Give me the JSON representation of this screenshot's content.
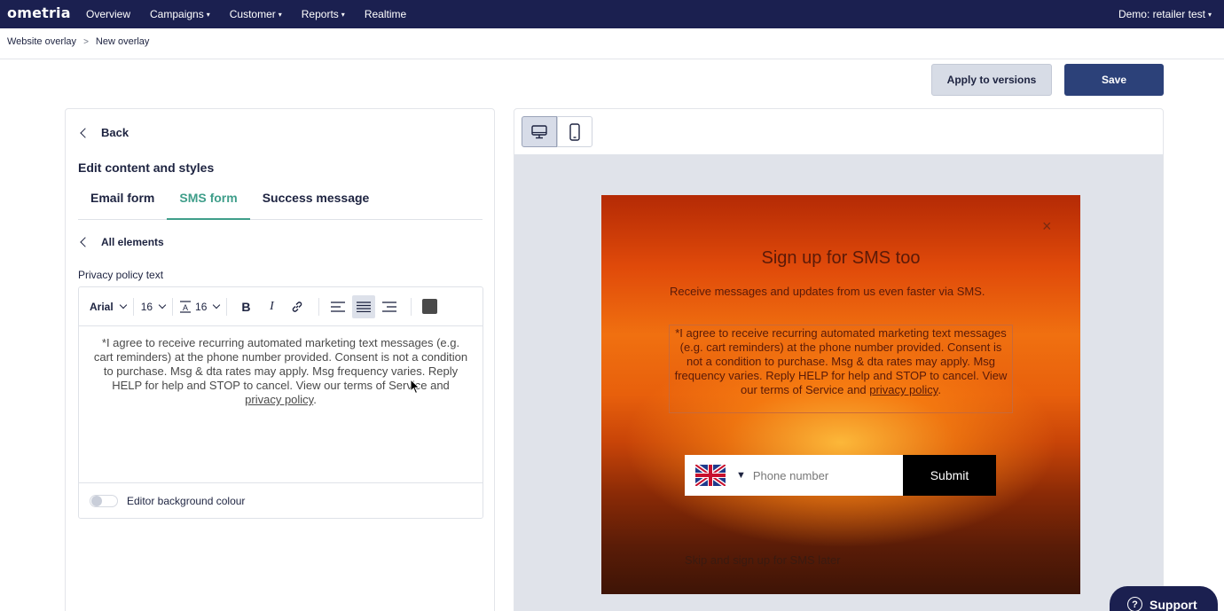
{
  "app": {
    "logo": "ometria",
    "nav": [
      {
        "label": "Overview",
        "caret": false
      },
      {
        "label": "Campaigns",
        "caret": true
      },
      {
        "label": "Customer",
        "caret": true
      },
      {
        "label": "Reports",
        "caret": true
      },
      {
        "label": "Realtime",
        "caret": false
      }
    ],
    "account_label": "Demo: retailer test"
  },
  "breadcrumb": [
    "Website overlay",
    "New overlay"
  ],
  "actions": {
    "apply_label": "Apply to versions",
    "save_label": "Save"
  },
  "editor_panel": {
    "back_label": "Back",
    "section_title": "Edit content and styles",
    "tabs": [
      {
        "label": "Email form",
        "active": false
      },
      {
        "label": "SMS form",
        "active": true
      },
      {
        "label": "Success message",
        "active": false
      }
    ],
    "all_elements_label": "All elements",
    "field_label": "Privacy policy text",
    "toolbar": {
      "font_family": "Arial",
      "font_size": "16",
      "line_height": "16",
      "text_color": "#4a4a4a"
    },
    "content_text": "*I agree to receive recurring automated marketing text messages (e.g. cart reminders) at the phone number provided. Consent is not a condition to purchase. Msg & dta rates may apply. Msg frequency varies. Reply HELP for help and STOP to cancel. View our terms of Service and ",
    "content_link": "privacy policy",
    "content_end": ".",
    "bg_colour_label": "Editor background colour",
    "bg_colour_enabled": false
  },
  "preview": {
    "device": "desktop",
    "close_glyph": "×",
    "title": "Sign up for SMS too",
    "subtitle": "Receive messages and updates from us even faster via SMS.",
    "privacy_text": "*I agree to receive recurring automated marketing text messages (e.g. cart reminders) at the phone number provided. Consent is not a condition to purchase. Msg & dta rates may apply. Msg frequency varies. Reply HELP for help and STOP to cancel. View our terms of Service and ",
    "privacy_link": "privacy policy",
    "privacy_end": ".",
    "country_arrow": "▼",
    "phone_placeholder": "Phone number",
    "submit_label": "Submit",
    "skip_label": "Skip and sign up for SMS later"
  },
  "support": {
    "label": "Support",
    "glyph": "?"
  },
  "colors": {
    "nav_bg": "#1b2050",
    "save_bg": "#2c4179",
    "active_tab": "#3f9e8a"
  }
}
